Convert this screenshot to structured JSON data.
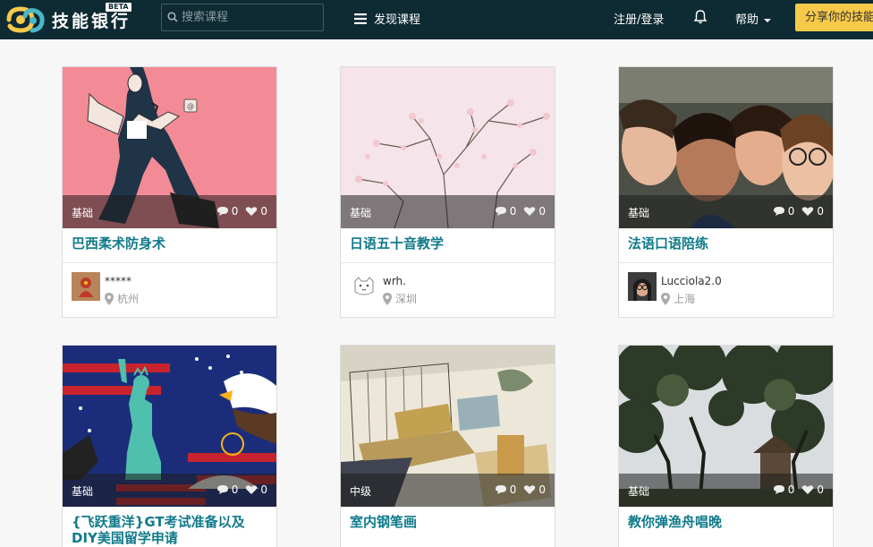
{
  "nav": {
    "brand": "技能银行",
    "beta": "BETA",
    "search_placeholder": "搜索课程",
    "discover": "发现课程",
    "login": "注册/登录",
    "help": "帮助",
    "share": "分享你的技能"
  },
  "cards": [
    {
      "level": "基础",
      "comments": "0",
      "likes": "0",
      "title": "巴西柔术防身术",
      "user": "*****",
      "city": "杭州"
    },
    {
      "level": "基础",
      "comments": "0",
      "likes": "0",
      "title": "日语五十音教学",
      "user": "wrh.",
      "city": "深圳"
    },
    {
      "level": "基础",
      "comments": "0",
      "likes": "0",
      "title": "法语口语陪练",
      "user": "Lucciola2.0",
      "city": "上海"
    },
    {
      "level": "基础",
      "comments": "0",
      "likes": "0",
      "title": "{飞跃重洋}GT考试准备以及DIY美国留学申请"
    },
    {
      "level": "中级",
      "comments": "0",
      "likes": "0",
      "title": "室内钢笔画"
    },
    {
      "level": "基础",
      "comments": "0",
      "likes": "0",
      "title": "教你弹渔舟唱晚"
    }
  ]
}
